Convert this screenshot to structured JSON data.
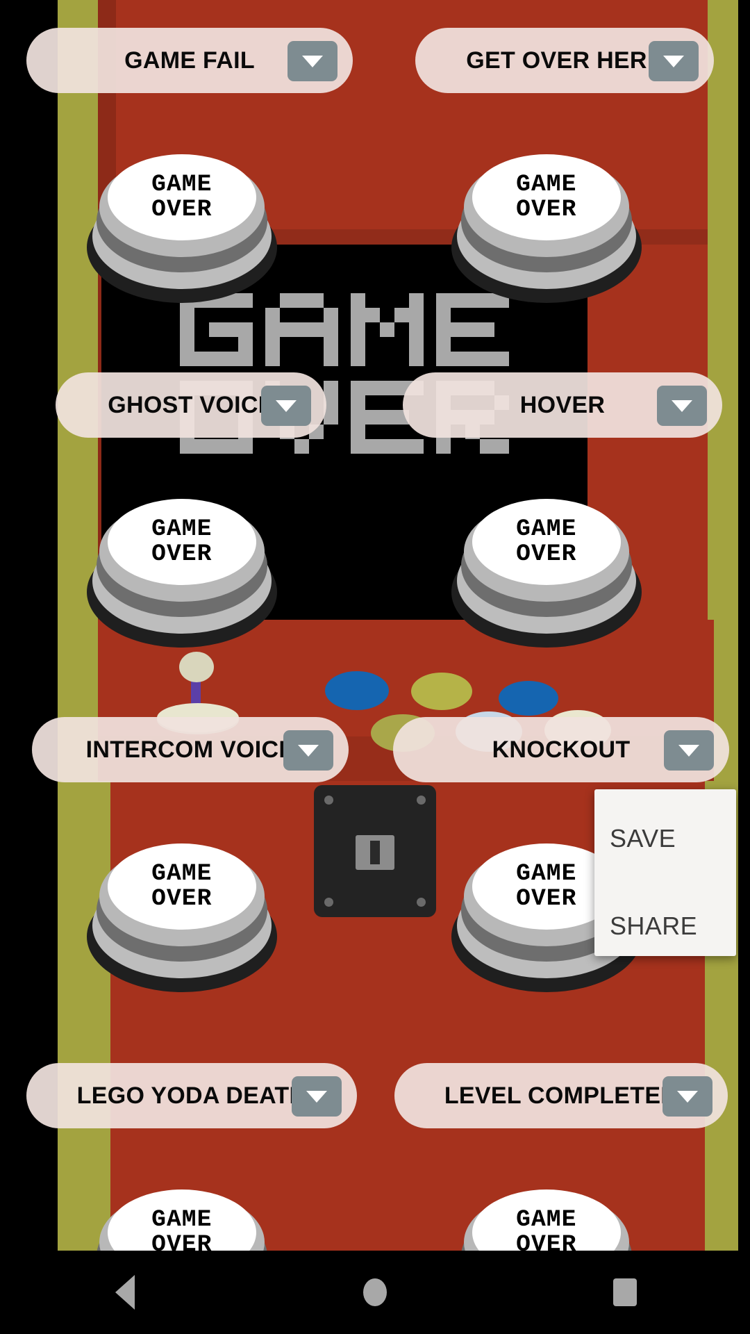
{
  "app": {
    "theme": {
      "cabinet_red": "#a6321d",
      "cabinet_yellow": "#a3a340",
      "screen_black": "#000000",
      "pill_bg": "#f0e2de",
      "dropdown_gray": "#7e8c91",
      "button_white": "#ffffff",
      "popup_bg": "#f5f4f2",
      "popup_text": "#3b3b3b",
      "nav_icon": "#a8a8a8"
    },
    "screen_text": {
      "line1": "GAME",
      "line2": "OVER"
    },
    "push_button": {
      "line1": "GAME",
      "line2": "OVER"
    }
  },
  "sound_rows": [
    {
      "left": {
        "label": "GAME FAIL",
        "dropdown": "chevron-down-icon"
      },
      "right": {
        "label": "GET OVER HERE",
        "dropdown": "chevron-down-icon"
      }
    },
    {
      "left": {
        "label": "GHOST VOICE",
        "dropdown": "chevron-down-icon"
      },
      "right": {
        "label": "HOVER",
        "dropdown": "chevron-down-icon"
      }
    },
    {
      "left": {
        "label": "INTERCOM VOICE",
        "dropdown": "chevron-down-icon"
      },
      "right": {
        "label": "KNOCKOUT",
        "dropdown": "chevron-down-icon"
      }
    },
    {
      "left": {
        "label": "LEGO YODA DEATH",
        "dropdown": "chevron-down-icon"
      },
      "right": {
        "label": "LEVEL COMPLETED",
        "dropdown": "chevron-down-icon"
      }
    }
  ],
  "popup_menu": {
    "items": [
      {
        "label": "SAVE"
      },
      {
        "label": "SHARE"
      }
    ]
  },
  "nav_bar": {
    "back": "back-triangle-icon",
    "home": "home-circle-icon",
    "recents": "recents-square-icon"
  },
  "arcade_controls": {
    "joystick": "joystick",
    "buttons": [
      {
        "name": "blue-arcade-button",
        "color": "#1565b0"
      },
      {
        "name": "yellow-arcade-button",
        "color": "#b5b348"
      },
      {
        "name": "blue-arcade-button-2",
        "color": "#1565b0"
      },
      {
        "name": "olive-arcade-button",
        "color": "#a9a74a"
      },
      {
        "name": "lightblue-arcade-button",
        "color": "#c6d8e8"
      },
      {
        "name": "cream-arcade-button",
        "color": "#eae7cf"
      }
    ],
    "coin_door": "coin-slot-panel"
  }
}
